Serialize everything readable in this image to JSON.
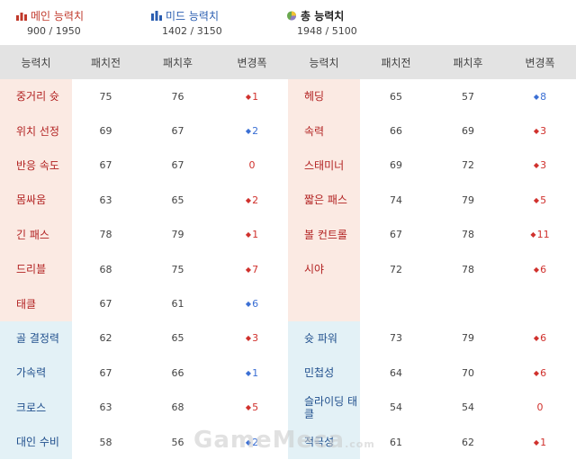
{
  "summary": {
    "main": {
      "label": "메인 능력치",
      "value": "900 / 1950",
      "color": "#c0392b",
      "icon": "bar-chart-red-icon"
    },
    "mid": {
      "label": "미드 능력치",
      "value": "1402 / 3150",
      "color": "#2a5db0",
      "icon": "bar-chart-blue-icon"
    },
    "total": {
      "label": "총 능력치",
      "value": "1948 / 5100",
      "icon": "pie-chart-icon"
    }
  },
  "headers": [
    "능력치",
    "패치전",
    "패치후",
    "변경폭",
    "능력치",
    "패치전",
    "패치후",
    "변경폭"
  ],
  "rows": [
    {
      "left": {
        "name": "중거리 슛",
        "before": "75",
        "after": "76",
        "diff": "1",
        "dir": "up",
        "group": "main"
      },
      "right": {
        "name": "헤딩",
        "before": "65",
        "after": "57",
        "diff": "8",
        "dir": "down",
        "group": "main"
      }
    },
    {
      "left": {
        "name": "위치 선정",
        "before": "69",
        "after": "67",
        "diff": "2",
        "dir": "down",
        "group": "main"
      },
      "right": {
        "name": "속력",
        "before": "66",
        "after": "69",
        "diff": "3",
        "dir": "up",
        "group": "main"
      }
    },
    {
      "left": {
        "name": "반응 속도",
        "before": "67",
        "after": "67",
        "diff": "0",
        "dir": "zero",
        "group": "main"
      },
      "right": {
        "name": "스태미너",
        "before": "69",
        "after": "72",
        "diff": "3",
        "dir": "up",
        "group": "main"
      }
    },
    {
      "left": {
        "name": "몸싸움",
        "before": "63",
        "after": "65",
        "diff": "2",
        "dir": "up",
        "group": "main"
      },
      "right": {
        "name": "짧은 패스",
        "before": "74",
        "after": "79",
        "diff": "5",
        "dir": "up",
        "group": "main"
      }
    },
    {
      "left": {
        "name": "긴 패스",
        "before": "78",
        "after": "79",
        "diff": "1",
        "dir": "up",
        "group": "main"
      },
      "right": {
        "name": "볼 컨트롤",
        "before": "67",
        "after": "78",
        "diff": "11",
        "dir": "up",
        "group": "main"
      }
    },
    {
      "left": {
        "name": "드리블",
        "before": "68",
        "after": "75",
        "diff": "7",
        "dir": "up",
        "group": "main"
      },
      "right": {
        "name": "시야",
        "before": "72",
        "after": "78",
        "diff": "6",
        "dir": "up",
        "group": "main"
      }
    },
    {
      "left": {
        "name": "태클",
        "before": "67",
        "after": "61",
        "diff": "6",
        "dir": "down",
        "group": "main"
      },
      "right": {
        "name": "",
        "before": "",
        "after": "",
        "diff": "",
        "dir": "none",
        "group": "blank"
      }
    },
    {
      "left": {
        "name": "골 결정력",
        "before": "62",
        "after": "65",
        "diff": "3",
        "dir": "up",
        "group": "mid"
      },
      "right": {
        "name": "슛 파워",
        "before": "73",
        "after": "79",
        "diff": "6",
        "dir": "up",
        "group": "mid"
      }
    },
    {
      "left": {
        "name": "가속력",
        "before": "67",
        "after": "66",
        "diff": "1",
        "dir": "down",
        "group": "mid"
      },
      "right": {
        "name": "민첩성",
        "before": "64",
        "after": "70",
        "diff": "6",
        "dir": "up",
        "group": "mid"
      }
    },
    {
      "left": {
        "name": "크로스",
        "before": "63",
        "after": "68",
        "diff": "5",
        "dir": "up",
        "group": "mid"
      },
      "right": {
        "name": "슬라이딩 태클",
        "before": "54",
        "after": "54",
        "diff": "0",
        "dir": "zero",
        "group": "mid"
      }
    },
    {
      "left": {
        "name": "대인 수비",
        "before": "58",
        "after": "56",
        "diff": "2",
        "dir": "down",
        "group": "mid"
      },
      "right": {
        "name": "적극성",
        "before": "61",
        "after": "62",
        "diff": "1",
        "dir": "up",
        "group": "mid"
      }
    }
  ],
  "watermark": {
    "text": "GameMeca",
    "suffix": ".com"
  },
  "colors": {
    "up": "#d0312d",
    "down": "#3b6fd4",
    "main_bg": "#fbeae3",
    "mid_bg": "#e3f1f6",
    "header_bg": "#e3e3e3"
  }
}
